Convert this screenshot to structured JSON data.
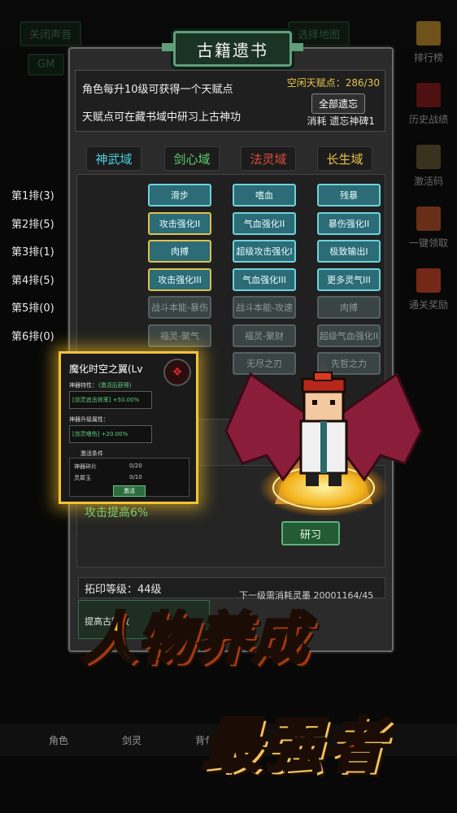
{
  "top_ghost_buttons": {
    "mute": "关闭声音",
    "map": "选择地图",
    "gm": "GM"
  },
  "sidebar": [
    {
      "label": "排行榜",
      "icon": "bar-chart-icon",
      "color": "#c9962e"
    },
    {
      "label": "历史战绩",
      "icon": "scroll-icon",
      "color": "#8e1e1e"
    },
    {
      "label": "激活码",
      "icon": "book-icon",
      "color": "#6b5a3a"
    },
    {
      "label": "一键领取",
      "icon": "chest-icon",
      "color": "#c0552a"
    },
    {
      "label": "通关奖励",
      "icon": "gift-icon",
      "color": "#d64a2a"
    }
  ],
  "panel": {
    "title": "古籍遗书",
    "info_line1": "角色每升10级可获得一个天赋点",
    "info_line2": "天赋点可在藏书域中研习上古神功",
    "free_points": "空闲天赋点：286/30",
    "all_forget": "全部遗忘",
    "cost": "消耗 遗忘神碑1"
  },
  "tabs": [
    {
      "label": "神武域",
      "color": "#4ad0e0"
    },
    {
      "label": "剑心域",
      "color": "#5fd070"
    },
    {
      "label": "法灵域",
      "color": "#e04a3a"
    },
    {
      "label": "长生域",
      "color": "#e8c04a"
    }
  ],
  "rows": [
    {
      "label": "第1排(3)",
      "cells": [
        {
          "t": "滑步",
          "s": "on"
        },
        {
          "t": "嗜血",
          "s": "on"
        },
        {
          "t": "残暴",
          "s": "on"
        }
      ]
    },
    {
      "label": "第2排(5)",
      "cells": [
        {
          "t": "攻击强化II",
          "s": "gold"
        },
        {
          "t": "气血强化II",
          "s": "on"
        },
        {
          "t": "暴伤强化II",
          "s": "on"
        }
      ]
    },
    {
      "label": "第3排(1)",
      "cells": [
        {
          "t": "肉搏",
          "s": "gold"
        },
        {
          "t": "超级攻击强化I",
          "s": "on"
        },
        {
          "t": "极致输出I",
          "s": "on"
        }
      ]
    },
    {
      "label": "第4排(5)",
      "cells": [
        {
          "t": "攻击强化III",
          "s": "gold"
        },
        {
          "t": "气血强化III",
          "s": "on"
        },
        {
          "t": "更多灵气III",
          "s": "on"
        }
      ]
    },
    {
      "label": "第5排(0)",
      "cells": [
        {
          "t": "战斗本能-暴伤",
          "s": "off"
        },
        {
          "t": "战斗本能-攻速",
          "s": "off"
        },
        {
          "t": "肉搏",
          "s": "off"
        }
      ]
    },
    {
      "label": "第6排(0)",
      "cells": [
        {
          "t": "福灵-聚气",
          "s": "off"
        },
        {
          "t": "福灵-聚财",
          "s": "off"
        },
        {
          "t": "超级气血强化II",
          "s": "off"
        }
      ]
    },
    {
      "label": "",
      "cells": [
        {
          "t": "",
          "s": "none"
        },
        {
          "t": "无尽之刃",
          "s": "off"
        },
        {
          "t": "先哲之力",
          "s": "off"
        }
      ]
    }
  ],
  "lower": {
    "attack_up": "攻击提高6%",
    "study": "研习",
    "level": "拓印等级：44级",
    "next": "下一级需消耗灵墨 20001164/45",
    "improve": "提高古籍效"
  },
  "popup": {
    "title": "魔化时空之翼(Lv",
    "trait_label": "神器特性：",
    "trait_state": "(激活后获得)",
    "trait_value": "[剑灵追击效率] +50.00%",
    "upgrade_label": "神器升级属性：",
    "upgrade_value": "[剑灵嗜伤] +20.00%",
    "cond_label": "激活条件",
    "mat1_name": "神器碎片",
    "mat1_count": "0/20",
    "mat2_name": "灵犀玉",
    "mat2_count": "0/10",
    "activate": "激活"
  },
  "bottom_nav": {
    "a": "角色",
    "b": "剑灵",
    "c": "背包"
  },
  "slogan": {
    "line1": "人物养成",
    "line2": "最强者"
  }
}
